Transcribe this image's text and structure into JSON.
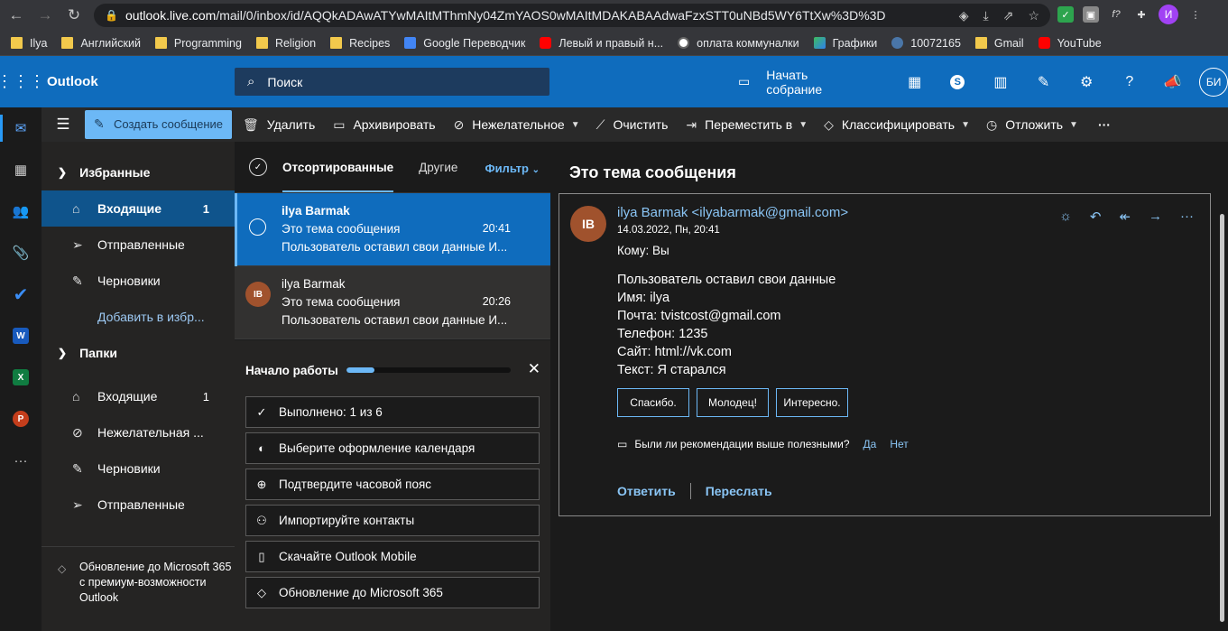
{
  "browser": {
    "url_domain": "outlook.live.com",
    "url_path": "/mail/0/inbox/id/AQQkADAwATYwMAItMThmNy04ZmYAOS0wMAItMDAKABAAdwaFzxSTT0uNBd5WY6TtXw%3D%3D",
    "profile_initial": "И",
    "bookmarks": [
      {
        "label": "Ilya",
        "icon": "folder"
      },
      {
        "label": "Английский",
        "icon": "folder"
      },
      {
        "label": "Programming",
        "icon": "folder"
      },
      {
        "label": "Religion",
        "icon": "folder"
      },
      {
        "label": "Recipes",
        "icon": "folder"
      },
      {
        "label": "Google Переводчик",
        "icon": "g"
      },
      {
        "label": "Левый и правый н...",
        "icon": "yt"
      },
      {
        "label": "оплата коммуналки",
        "icon": "pay"
      },
      {
        "label": "Графики",
        "icon": "graf"
      },
      {
        "label": "10072165",
        "icon": "vk"
      },
      {
        "label": "Gmail",
        "icon": "folder"
      },
      {
        "label": "YouTube",
        "icon": "yt"
      }
    ]
  },
  "header": {
    "brand": "Outlook",
    "search_placeholder": "Поиск",
    "meet_label": "Начать собрание",
    "avatar": "БИ",
    "color": "#0f6cbd"
  },
  "toolbar": {
    "new_message": "Создать сообщение",
    "delete": "Удалить",
    "archive": "Архивировать",
    "junk": "Нежелательное",
    "sweep": "Очистить",
    "move": "Переместить в",
    "categorize": "Классифицировать",
    "snooze": "Отложить",
    "more": "···"
  },
  "folders": {
    "favorites_label": "Избранные",
    "favorites": [
      {
        "label": "Входящие",
        "count": "1",
        "icon": "inbox-icon"
      },
      {
        "label": "Отправленные",
        "count": "",
        "icon": "send-icon"
      },
      {
        "label": "Черновики",
        "count": "",
        "icon": "pencil-icon"
      }
    ],
    "add_favorite": "Добавить в избр...",
    "folders_label": "Папки",
    "list": [
      {
        "label": "Входящие",
        "count": "1",
        "icon": "inbox-icon"
      },
      {
        "label": "Нежелательная ...",
        "count": "",
        "icon": "block-icon"
      },
      {
        "label": "Черновики",
        "count": "",
        "icon": "pencil-icon"
      },
      {
        "label": "Отправленные",
        "count": "",
        "icon": "send-icon"
      }
    ],
    "upgrade": "Обновление до Microsoft 365 с премиум-возможности Outlook"
  },
  "message_list": {
    "tab_focused": "Отсортированные",
    "tab_other": "Другие",
    "filter": "Фильтр",
    "messages": [
      {
        "from": "ilya Barmak",
        "subject": "Это тема сообщения",
        "time": "20:41",
        "preview": "Пользователь оставил свои данные И...",
        "selected": true
      },
      {
        "from": "ilya Barmak",
        "subject": "Это тема сообщения",
        "time": "20:26",
        "preview": "Пользователь оставил свои данные И...",
        "initials": "IB"
      }
    ]
  },
  "getting_started": {
    "title": "Начало работы",
    "progress": 0.17,
    "items": [
      {
        "label": "Выполнено: 1 из 6",
        "icon": "check-icon"
      },
      {
        "label": "Выберите оформление календаря",
        "icon": "palette-icon"
      },
      {
        "label": "Подтвердите часовой пояс",
        "icon": "globe-icon"
      },
      {
        "label": "Импортируйте контакты",
        "icon": "person-add-icon"
      },
      {
        "label": "Скачайте Outlook Mobile",
        "icon": "phone-icon"
      },
      {
        "label": "Обновление до Microsoft 365",
        "icon": "diamond-icon"
      }
    ]
  },
  "reading": {
    "subject": "Это тема сообщения",
    "initials": "IB",
    "sender": "ilya Barmak <ilyabarmak@gmail.com>",
    "date": "14.03.2022, Пн, 20:41",
    "to": "Кому:  Вы",
    "body": [
      "Пользователь оставил свои данные",
      "Имя: ilya",
      "Почта: tvistcost@gmail.com",
      "Телефон: 1235",
      "Сайт: html://vk.com",
      "Текст: Я старался"
    ],
    "quick_replies": [
      "Спасибо.",
      "Молодец!",
      "Интересно."
    ],
    "helpful_question": "Были ли рекомендации выше полезными?",
    "yes": "Да",
    "no": "Нет",
    "reply": "Ответить",
    "forward": "Переслать"
  }
}
